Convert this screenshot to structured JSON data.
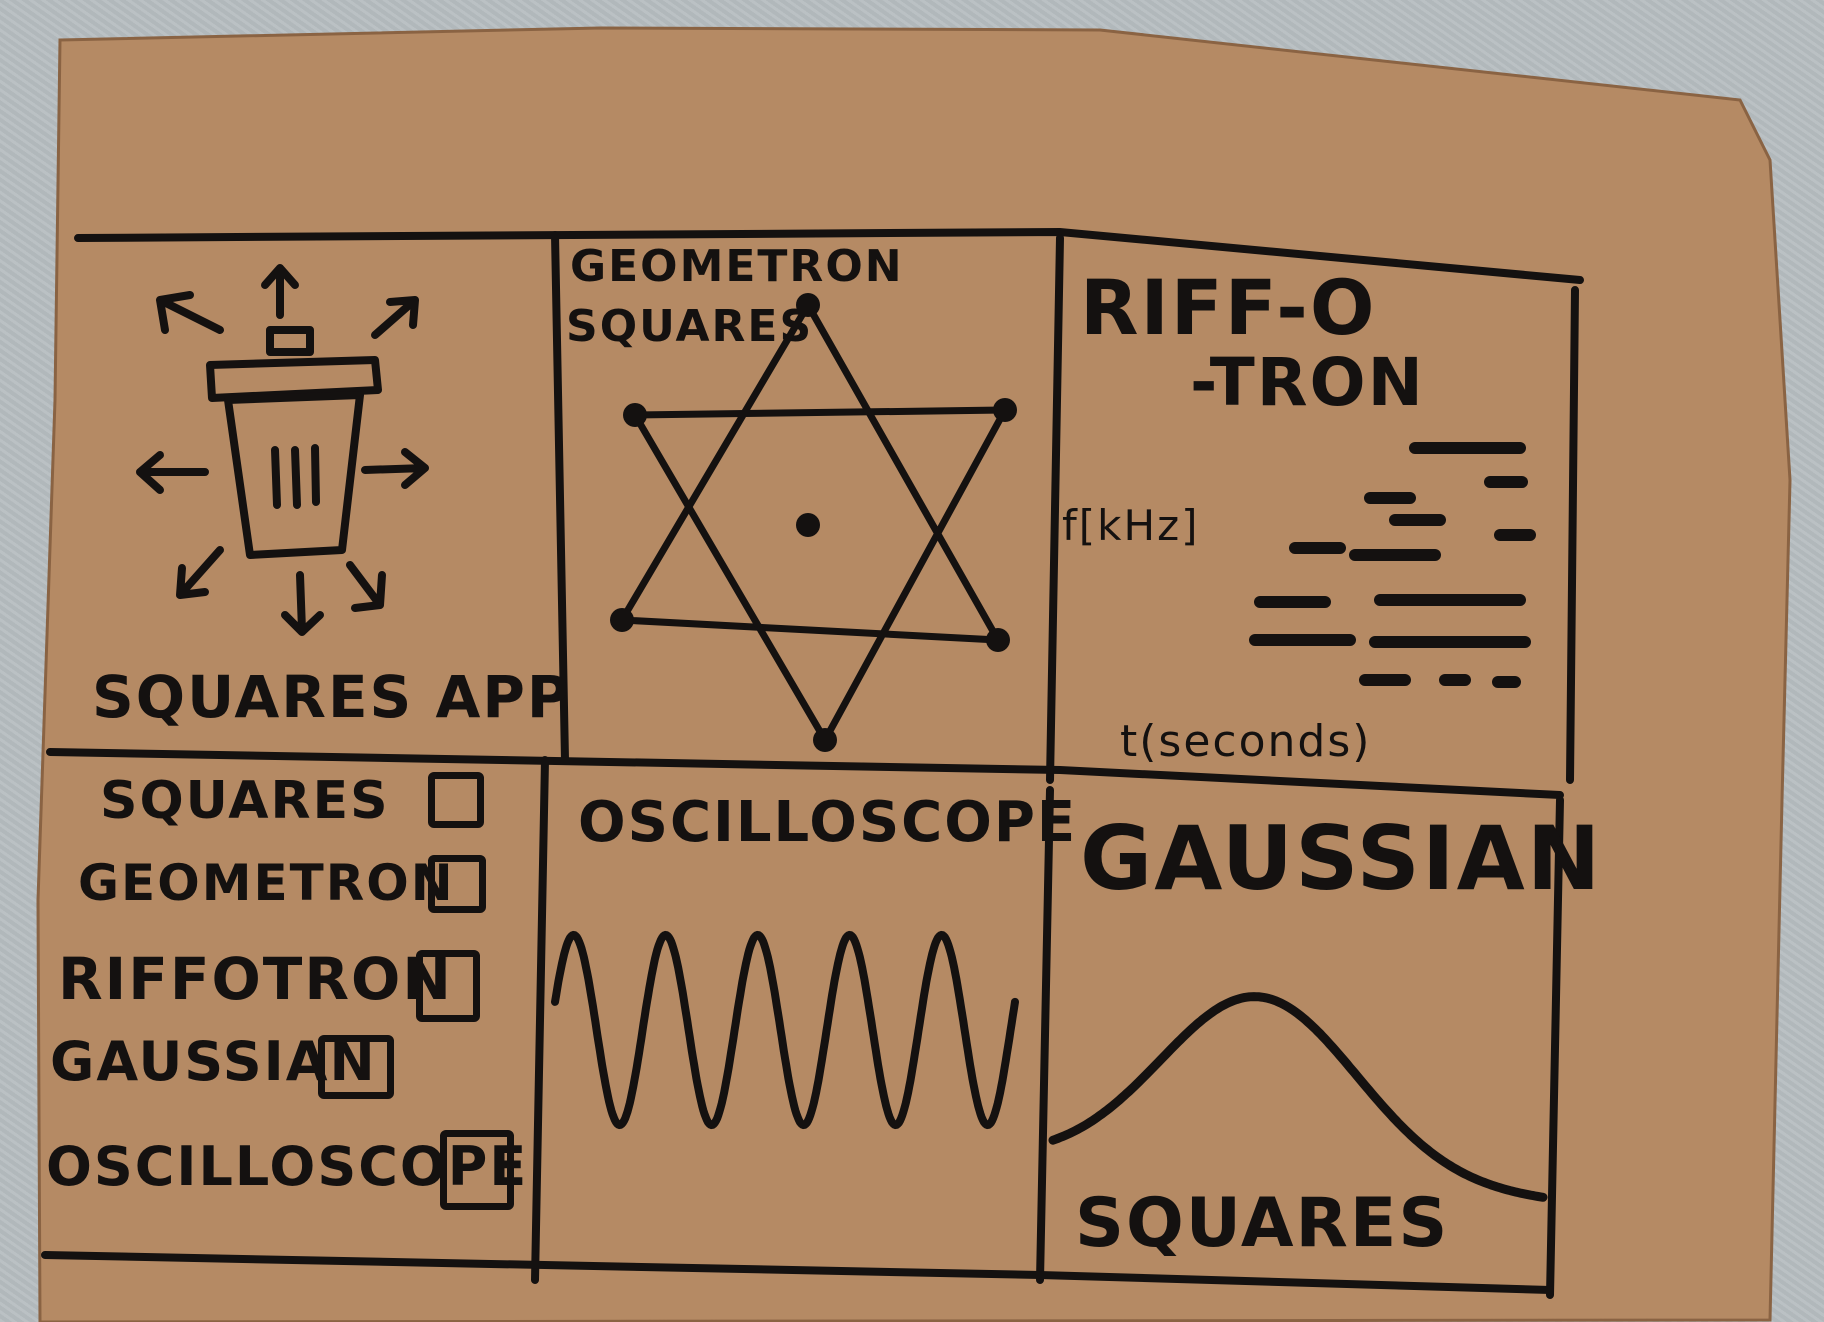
{
  "colors": {
    "cardboard": "#b58a64",
    "ink": "#141110",
    "background": "#b7bec1"
  },
  "panels": {
    "squares_app": {
      "title": "SQUARES APP",
      "icon": "trash-can-explode-icon"
    },
    "geometron": {
      "title_line1": "GEOMETRON",
      "title_line2": "SQUARES"
    },
    "riffotron": {
      "title_line1": "RIFF-O",
      "title_line2": "-TRON",
      "y_label": "f[kHz]",
      "x_label": "t(seconds)"
    },
    "selector": {
      "options": [
        {
          "label": "SQUARES",
          "checked": false
        },
        {
          "label": "GEOMETRON",
          "checked": false
        },
        {
          "label": "RIFFOTRON",
          "checked": false
        },
        {
          "label": "GAUSSIAN",
          "checked": false
        },
        {
          "label": "OSCILLOSCOPE",
          "checked": false
        }
      ]
    },
    "oscilloscope": {
      "title": "OSCILLOSCOPE",
      "wave_cycles": 5
    },
    "gaussian": {
      "title": "GAUSSIAN",
      "x_label": "SQUARES"
    }
  }
}
